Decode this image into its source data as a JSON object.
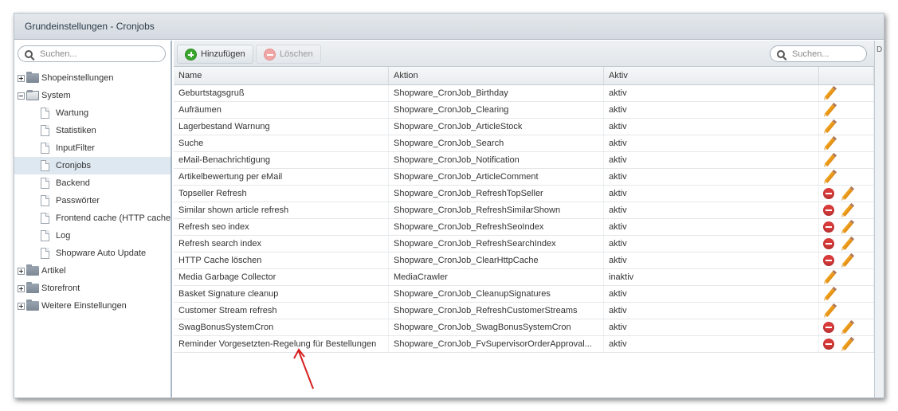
{
  "window": {
    "title": "Grundeinstellungen - Cronjobs"
  },
  "left": {
    "search_placeholder": "Suchen...",
    "tree": [
      {
        "label": "Shopeinstellungen",
        "type": "folder",
        "expanded": false
      },
      {
        "label": "System",
        "type": "folder",
        "expanded": true
      },
      {
        "label": "Wartung",
        "type": "leaf"
      },
      {
        "label": "Statistiken",
        "type": "leaf"
      },
      {
        "label": "InputFilter",
        "type": "leaf"
      },
      {
        "label": "Cronjobs",
        "type": "leaf",
        "selected": true
      },
      {
        "label": "Backend",
        "type": "leaf"
      },
      {
        "label": "Passwörter",
        "type": "leaf"
      },
      {
        "label": "Frontend cache (HTTP cache)",
        "type": "leaf"
      },
      {
        "label": "Log",
        "type": "leaf"
      },
      {
        "label": "Shopware Auto Update",
        "type": "leaf"
      },
      {
        "label": "Artikel",
        "type": "folder",
        "expanded": false
      },
      {
        "label": "Storefront",
        "type": "folder",
        "expanded": false
      },
      {
        "label": "Weitere Einstellungen",
        "type": "folder",
        "expanded": false
      }
    ]
  },
  "toolbar": {
    "add_label": "Hinzufügen",
    "delete_label": "Löschen",
    "search_placeholder": "Suchen..."
  },
  "grid": {
    "columns": {
      "name": "Name",
      "action": "Aktion",
      "active": "Aktiv"
    },
    "rows": [
      {
        "name": "Geburtstagsgruß",
        "action": "Shopware_CronJob_Birthday",
        "active": "aktiv",
        "deletable": false
      },
      {
        "name": "Aufräumen",
        "action": "Shopware_CronJob_Clearing",
        "active": "aktiv",
        "deletable": false
      },
      {
        "name": "Lagerbestand Warnung",
        "action": "Shopware_CronJob_ArticleStock",
        "active": "aktiv",
        "deletable": false
      },
      {
        "name": "Suche",
        "action": "Shopware_CronJob_Search",
        "active": "aktiv",
        "deletable": false
      },
      {
        "name": "eMail-Benachrichtigung",
        "action": "Shopware_CronJob_Notification",
        "active": "aktiv",
        "deletable": false
      },
      {
        "name": "Artikelbewertung per eMail",
        "action": "Shopware_CronJob_ArticleComment",
        "active": "aktiv",
        "deletable": false
      },
      {
        "name": "Topseller Refresh",
        "action": "Shopware_CronJob_RefreshTopSeller",
        "active": "aktiv",
        "deletable": true
      },
      {
        "name": "Similar shown article refresh",
        "action": "Shopware_CronJob_RefreshSimilarShown",
        "active": "aktiv",
        "deletable": true
      },
      {
        "name": "Refresh seo index",
        "action": "Shopware_CronJob_RefreshSeoIndex",
        "active": "aktiv",
        "deletable": true
      },
      {
        "name": "Refresh search index",
        "action": "Shopware_CronJob_RefreshSearchIndex",
        "active": "aktiv",
        "deletable": true
      },
      {
        "name": "HTTP Cache löschen",
        "action": "Shopware_CronJob_ClearHttpCache",
        "active": "aktiv",
        "deletable": true
      },
      {
        "name": "Media Garbage Collector",
        "action": "MediaCrawler",
        "active": "inaktiv",
        "deletable": false
      },
      {
        "name": "Basket Signature cleanup",
        "action": "Shopware_CronJob_CleanupSignatures",
        "active": "aktiv",
        "deletable": false
      },
      {
        "name": "Customer Stream refresh",
        "action": "Shopware_CronJob_RefreshCustomerStreams",
        "active": "aktiv",
        "deletable": false
      },
      {
        "name": "SwagBonusSystemCron",
        "action": "Shopware_CronJob_SwagBonusSystemCron",
        "active": "aktiv",
        "deletable": true
      },
      {
        "name": "Reminder Vorgesetzten-Regelung für Bestellungen",
        "action": "Shopware_CronJob_FvSupervisorOrderApproval...",
        "active": "aktiv",
        "deletable": true
      }
    ]
  },
  "right_edge_letter": "D",
  "colors": {
    "accent_green": "#3aa62e",
    "delete_red": "#d93a3a",
    "arrow_red": "#d61f1f",
    "selected_bg": "#dde8f1"
  }
}
